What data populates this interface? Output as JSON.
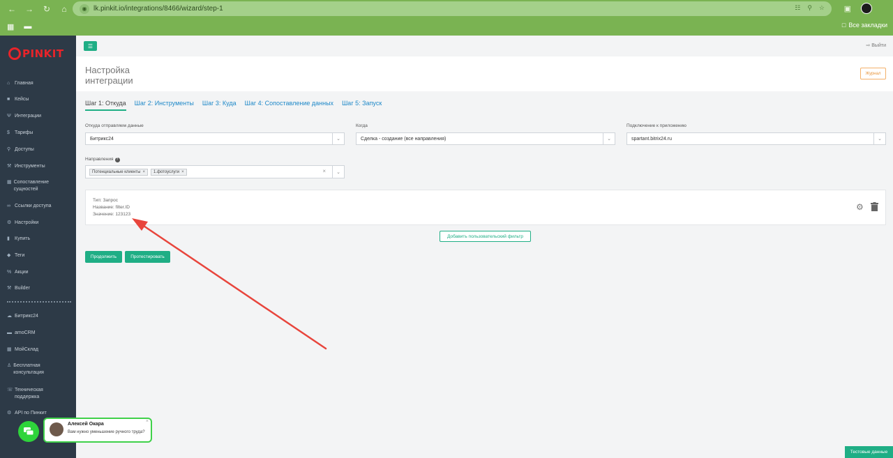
{
  "browser": {
    "url": "lk.pinkit.io/integrations/8466/wizard/step-1",
    "bookmarks_label": "Все закладки"
  },
  "brand": {
    "logo_text": "PINKIT"
  },
  "sidebar": {
    "items": [
      {
        "label": "Главная",
        "icon": "home-icon"
      },
      {
        "label": "Кейсы",
        "icon": "briefcase-icon"
      },
      {
        "label": "Интеграции",
        "icon": "plug-icon"
      },
      {
        "label": "Тарифы",
        "icon": "dollar-icon"
      },
      {
        "label": "Доступы",
        "icon": "key-icon"
      },
      {
        "label": "Инструменты",
        "icon": "wrench-icon"
      },
      {
        "label": "Сопоставление сущностей",
        "icon": "table-icon"
      },
      {
        "label": "Ссылки доступа",
        "icon": "link-icon"
      },
      {
        "label": "Настройки",
        "icon": "settings-icon"
      },
      {
        "label": "Купить",
        "icon": "cart-icon"
      },
      {
        "label": "Теги",
        "icon": "tag-icon"
      },
      {
        "label": "Акции",
        "icon": "percent-icon"
      },
      {
        "label": "Builder",
        "icon": "wrench-icon"
      },
      {
        "label": "Битрикс24",
        "icon": "cloud-icon"
      },
      {
        "label": "amoCRM",
        "icon": "crm-icon"
      },
      {
        "label": "МойСклад",
        "icon": "warehouse-icon"
      },
      {
        "label": "Бесплатная консультация",
        "icon": "user-icon"
      },
      {
        "label": "Техническая поддержка",
        "icon": "support-icon"
      },
      {
        "label": "API по Пинкит",
        "icon": "api-icon"
      }
    ]
  },
  "topbar": {
    "logout_label": "Выйти"
  },
  "header": {
    "title": "Настройка интеграции",
    "journal_label": "Журнал"
  },
  "steps": [
    {
      "label": "Шаг 1: Откуда",
      "active": true
    },
    {
      "label": "Шаг 2: Инструменты",
      "active": false
    },
    {
      "label": "Шаг 3: Куда",
      "active": false
    },
    {
      "label": "Шаг 4: Сопоставление данных",
      "active": false
    },
    {
      "label": "Шаг 5: Запуск",
      "active": false
    }
  ],
  "form": {
    "source_label": "Откуда отправляем данные",
    "source_value": "Битрикс24",
    "when_label": "Когда",
    "when_value": "Сделка - создание (все направления)",
    "connection_label": "Подключение к приложению",
    "connection_value": "spartant.bitrix24.ru",
    "directions_label": "Направления",
    "directions_tags": [
      "Потенциальные клиенты",
      "1.фотоуслуги"
    ]
  },
  "filter": {
    "type_line": "Тип: Запрос",
    "name_line": "Название: filter.ID",
    "value_line": "Значение: 123123"
  },
  "buttons": {
    "add_filter": "Добавить пользовательский фильтр",
    "continue": "Продолжить",
    "test": "Протестировать",
    "test_data": "Тестовые данные"
  },
  "chat": {
    "name": "Алексей Окара",
    "message": "Вам нужно уменьшение ручного труда?"
  },
  "colors": {
    "accent": "#1fae85",
    "sidebar": "#2d3a47",
    "logo": "#e8242a",
    "annotation_arrow": "#e8453c",
    "browser": "#7ab352"
  }
}
